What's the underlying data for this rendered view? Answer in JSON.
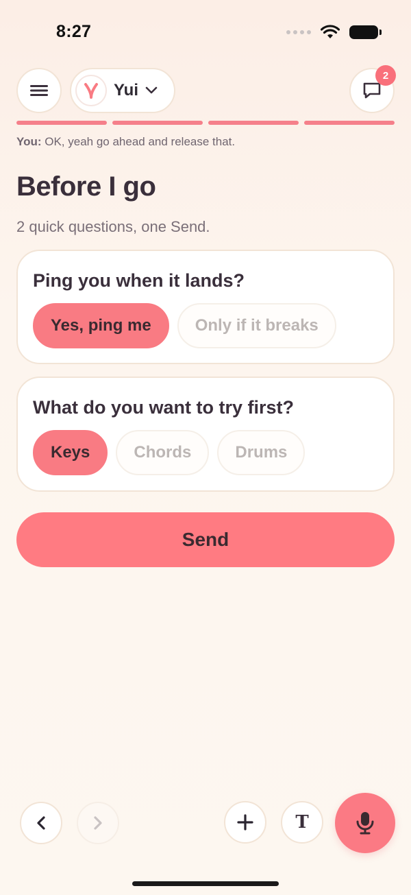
{
  "status_bar": {
    "time": "8:27",
    "icons": [
      "signal-dots-icon",
      "wifi-icon",
      "battery-icon"
    ]
  },
  "header": {
    "menu_icon": "hamburger-menu-icon",
    "persona": {
      "name": "Yui",
      "avatar_icon": "y-logo-icon",
      "dropdown_icon": "chevron-down-icon"
    },
    "chat": {
      "icon": "chat-bubble-icon",
      "badge_count": "2"
    },
    "progress_segments": 4
  },
  "context": {
    "you_label": "You:",
    "you_text": " OK, yeah go ahead and release that."
  },
  "main": {
    "title": "Before I go",
    "subtitle": "2 quick questions, one Send.",
    "questions": [
      {
        "question": "Ping you when it lands?",
        "options": [
          "Yes, ping me",
          "Only if it breaks"
        ],
        "selected": "Yes, ping me"
      },
      {
        "question": "What do you want to try first?",
        "options": [
          "Keys",
          "Chords",
          "Drums"
        ],
        "selected": "Keys"
      }
    ],
    "send_label": "Send"
  },
  "bottom_bar": {
    "back_icon": "chevron-left-icon",
    "forward_icon": "chevron-right-icon",
    "add_icon": "plus-icon",
    "text_label": "T",
    "mic_icon": "microphone-icon"
  },
  "colors": {
    "accent": "#f97b83",
    "text_dark": "#3a2f3b",
    "muted": "#7a6f78",
    "card_border": "#f2e4d6"
  }
}
